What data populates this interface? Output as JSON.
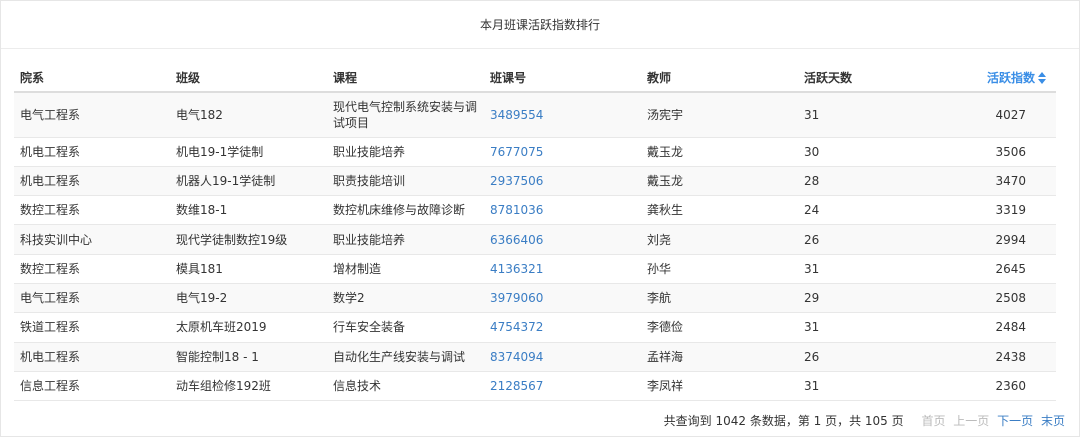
{
  "title": "本月班课活跃指数排行",
  "columns": [
    "院系",
    "班级",
    "课程",
    "班课号",
    "教师",
    "活跃天数",
    "活跃指数"
  ],
  "rows": [
    [
      "电气工程系",
      "电气182",
      "现代电气控制系统安装与调试项目",
      "3489554",
      "汤宪宇",
      "31",
      "4027"
    ],
    [
      "机电工程系",
      "机电19-1学徒制",
      "职业技能培养",
      "7677075",
      "戴玉龙",
      "30",
      "3506"
    ],
    [
      "机电工程系",
      "机器人19-1学徒制",
      "职责技能培训",
      "2937506",
      "戴玉龙",
      "28",
      "3470"
    ],
    [
      "数控工程系",
      "数维18-1",
      "数控机床维修与故障诊断",
      "8781036",
      "龚秋生",
      "24",
      "3319"
    ],
    [
      "科技实训中心",
      "现代学徒制数控19级",
      "职业技能培养",
      "6366406",
      "刘尧",
      "26",
      "2994"
    ],
    [
      "数控工程系",
      "模具181",
      "增材制造",
      "4136321",
      "孙华",
      "31",
      "2645"
    ],
    [
      "电气工程系",
      "电气19-2",
      "数学2",
      "3979060",
      "李航",
      "29",
      "2508"
    ],
    [
      "铁道工程系",
      "太原机车班2019",
      "行车安全装备",
      "4754372",
      "李德俭",
      "31",
      "2484"
    ],
    [
      "机电工程系",
      "智能控制18 - 1",
      "自动化生产线安装与调试",
      "8374094",
      "孟祥海",
      "26",
      "2438"
    ],
    [
      "信息工程系",
      "动车组检修192班",
      "信息技术",
      "2128567",
      "李凤祥",
      "31",
      "2360"
    ]
  ],
  "footer": {
    "summary": "共查询到 1042 条数据，第 1 页，共 105 页",
    "first": "首页",
    "prev": "上一页",
    "next": "下一页",
    "last": "末页"
  }
}
